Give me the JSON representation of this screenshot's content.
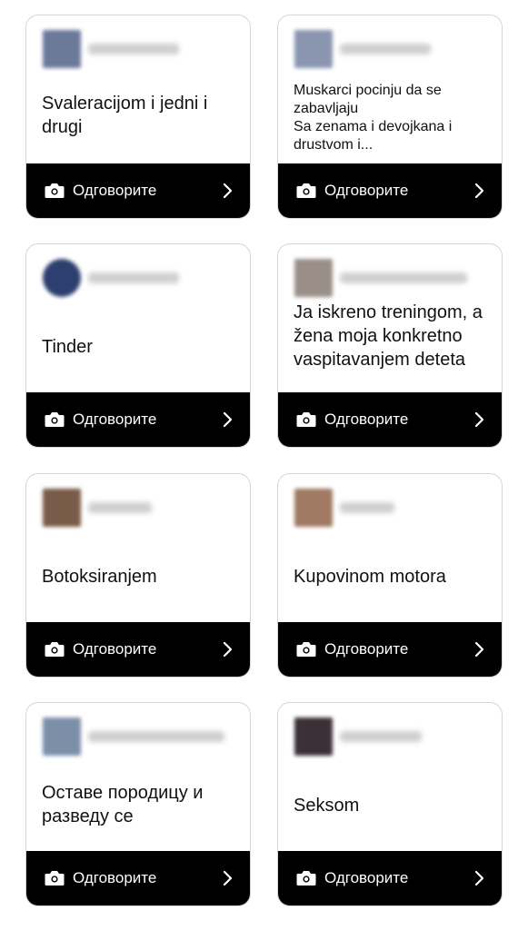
{
  "cards": [
    {
      "text": "Svaleracijom i jedni i drugi",
      "button_label": "Одговорите",
      "avatar_color": "#6c7a9a"
    },
    {
      "text": "Muskarci pocinju da se zabavljaju\nSa zenama i devojkana i drustvom i...",
      "button_label": "Одговорите",
      "avatar_color": "#8a96b0"
    },
    {
      "text": "Tinder",
      "button_label": "Одговорите",
      "avatar_color": "#2c3f6e"
    },
    {
      "text": "Ja iskreno treningom, a žena moja konkretno vaspitavanjem deteta",
      "button_label": "Одговорите",
      "avatar_color": "#9a8f88"
    },
    {
      "text": "Botoksiranjem",
      "button_label": "Одговорите",
      "avatar_color": "#7a5a48"
    },
    {
      "text": "Kupovinom motora",
      "button_label": "Одговорите",
      "avatar_color": "#a07a62"
    },
    {
      "text": "Оставе породицу и разведу се",
      "button_label": "Одговорите",
      "avatar_color": "#7c8fa8"
    },
    {
      "text": "Seksom",
      "button_label": "Одговорите",
      "avatar_color": "#3a3036"
    }
  ]
}
